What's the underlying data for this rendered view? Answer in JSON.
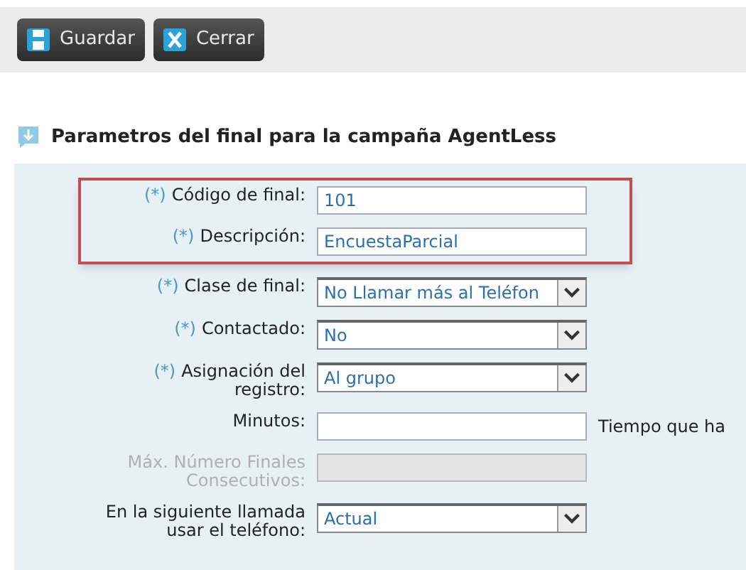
{
  "toolbar": {
    "buttons": [
      {
        "kind": "save",
        "label": "Guardar"
      },
      {
        "kind": "close",
        "label": "Cerrar"
      }
    ]
  },
  "heading": "Parametros del final para la campaña AgentLess",
  "fields": [
    {
      "kind": "text",
      "required_mark": "(*)",
      "highlighted": true,
      "label": [
        "Código de final:"
      ],
      "value": "101"
    },
    {
      "kind": "text",
      "required_mark": "(*)",
      "highlighted": true,
      "label": [
        "Descripción:"
      ],
      "value": "EncuestaParcial"
    },
    {
      "kind": "select",
      "required_mark": "(*)",
      "highlighted": false,
      "label": [
        "Clase de final:"
      ],
      "value": "No Llamar más al Teléfon"
    },
    {
      "kind": "select",
      "required_mark": "(*)",
      "highlighted": false,
      "label": [
        "Contactado:"
      ],
      "value": "No"
    },
    {
      "kind": "select",
      "required_mark": "(*)",
      "highlighted": false,
      "label": [
        "Asignación del",
        "registro:"
      ],
      "value": "Al grupo"
    },
    {
      "kind": "text",
      "highlighted": false,
      "label": [
        "Minutos:"
      ],
      "note": "Tiempo que ha"
    },
    {
      "kind": "disabled",
      "highlighted": false,
      "label": [
        "Máx. Número Finales",
        "Consecutivos:"
      ]
    },
    {
      "kind": "select",
      "highlighted": false,
      "label": [
        "En la siguiente llamada",
        "usar el teléfono:"
      ],
      "value": "Actual"
    }
  ]
}
